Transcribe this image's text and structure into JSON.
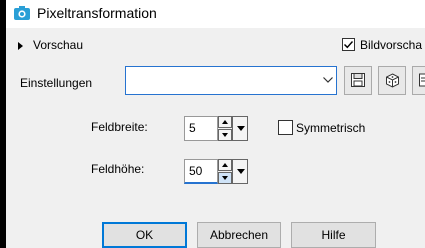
{
  "window": {
    "title": "Pixeltransformation"
  },
  "preview": {
    "label": "Vorschau",
    "checkbox_label": "Bildvorscha",
    "checked": true
  },
  "settings": {
    "label": "Einstellungen",
    "combo_value": ""
  },
  "fields": {
    "width": {
      "label": "Feldbreite:",
      "value": "5"
    },
    "height": {
      "label": "Feldhöhe:",
      "value": "50"
    }
  },
  "symmetric": {
    "label": "Symmetrisch",
    "checked": false
  },
  "buttons": {
    "ok": "OK",
    "cancel": "Abbrechen",
    "help": "Hilfe"
  },
  "colors": {
    "accent": "#0078d7",
    "dialog_bg": "#f0f0f0",
    "app_icon": "#2a9fd6"
  },
  "icons": [
    "camera-icon",
    "expander-arrow-icon",
    "chevron-down-icon",
    "save-icon",
    "randomize-icon",
    "preset-icon"
  ]
}
